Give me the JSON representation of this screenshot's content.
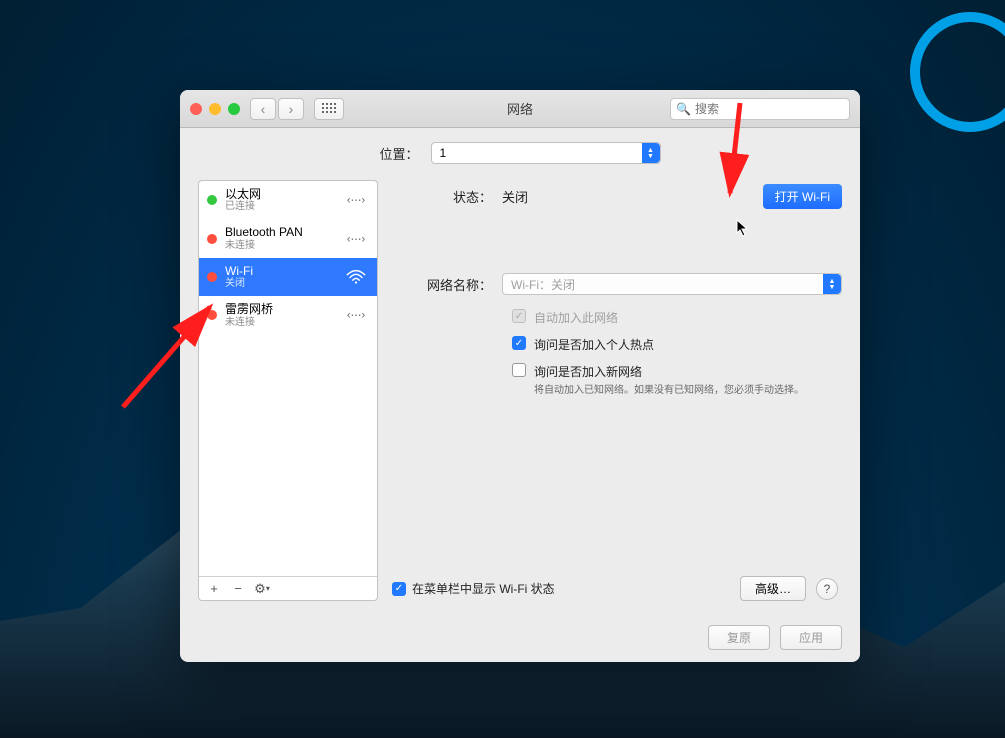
{
  "window": {
    "title": "网络",
    "search_placeholder": "搜索"
  },
  "location": {
    "label": "位置：",
    "value": "1"
  },
  "sidebar": {
    "items": [
      {
        "name": "以太网",
        "status": "已连接",
        "dot": "green",
        "icon": "ethernet"
      },
      {
        "name": "Bluetooth PAN",
        "status": "未连接",
        "dot": "red",
        "icon": "ethernet"
      },
      {
        "name": "Wi-Fi",
        "status": "关闭",
        "dot": "red",
        "icon": "wifi",
        "selected": true
      },
      {
        "name": "雷雳网桥",
        "status": "未连接",
        "dot": "red",
        "icon": "ethernet"
      }
    ],
    "footer": {
      "add": "+",
      "remove": "−",
      "gear": "⚙︎"
    }
  },
  "detail": {
    "status_label": "状态：",
    "status_value": "关闭",
    "toggle_button": "打开 Wi-Fi",
    "netname_label": "网络名称：",
    "netname_placeholder": "Wi-Fi：关闭",
    "auto_join": {
      "label": "自动加入此网络",
      "checked": true,
      "disabled": true
    },
    "ask_hotspot": {
      "label": "询问是否加入个人热点",
      "checked": true
    },
    "ask_new": {
      "label": "询问是否加入新网络",
      "checked": false
    },
    "help_text": "将自动加入已知网络。如果没有已知网络，您必须手动选择。",
    "menubar": {
      "label": "在菜单栏中显示 Wi-Fi 状态",
      "checked": true
    },
    "advanced_button": "高级…",
    "help_button": "?"
  },
  "footer": {
    "revert": "复原",
    "apply": "应用"
  }
}
